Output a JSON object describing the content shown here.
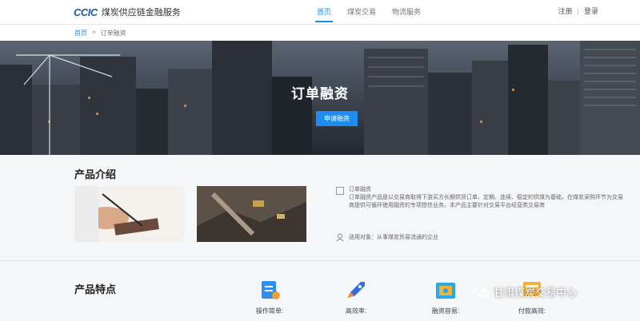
{
  "header": {
    "logo_mark": "CCIC",
    "logo_text": "煤炭供应链金融服务",
    "nav": [
      {
        "label": "首页",
        "active": true
      },
      {
        "label": "煤炭交易",
        "active": false
      },
      {
        "label": "物流服务",
        "active": false
      }
    ],
    "register": "注册",
    "separator": "|",
    "login": "登录"
  },
  "breadcrumb": {
    "home": "首页",
    "separator": ">",
    "current": "订单融资"
  },
  "hero": {
    "title": "订单融资",
    "button": "申请融资"
  },
  "intro": {
    "title": "产品介绍",
    "desc_heading": "订单融资",
    "desc_body": "订单融资产品是以交易商取得下游买方长期供货订单、定期、连续、稳定的供煤为基础，在煤炭采购环节为交易商提供可循环使用融资的专项授信业务。本产品主要针对交易平台经营类交易商",
    "target": "适用对象：从事煤炭贸易流通的企业"
  },
  "features": {
    "title": "产品特点",
    "items": [
      {
        "label": "操作简单:",
        "icon": "document-icon",
        "color": "#2f8ff0"
      },
      {
        "label": "高效率:",
        "icon": "rocket-icon",
        "color": "#f08a2f"
      },
      {
        "label": "融资容易:",
        "icon": "wallet-icon",
        "color": "#2aa8e8"
      },
      {
        "label": "付款高效:",
        "icon": "payment-icon",
        "color": "#f2b233"
      }
    ]
  },
  "watermark": "甘肃煤炭交易中心"
}
